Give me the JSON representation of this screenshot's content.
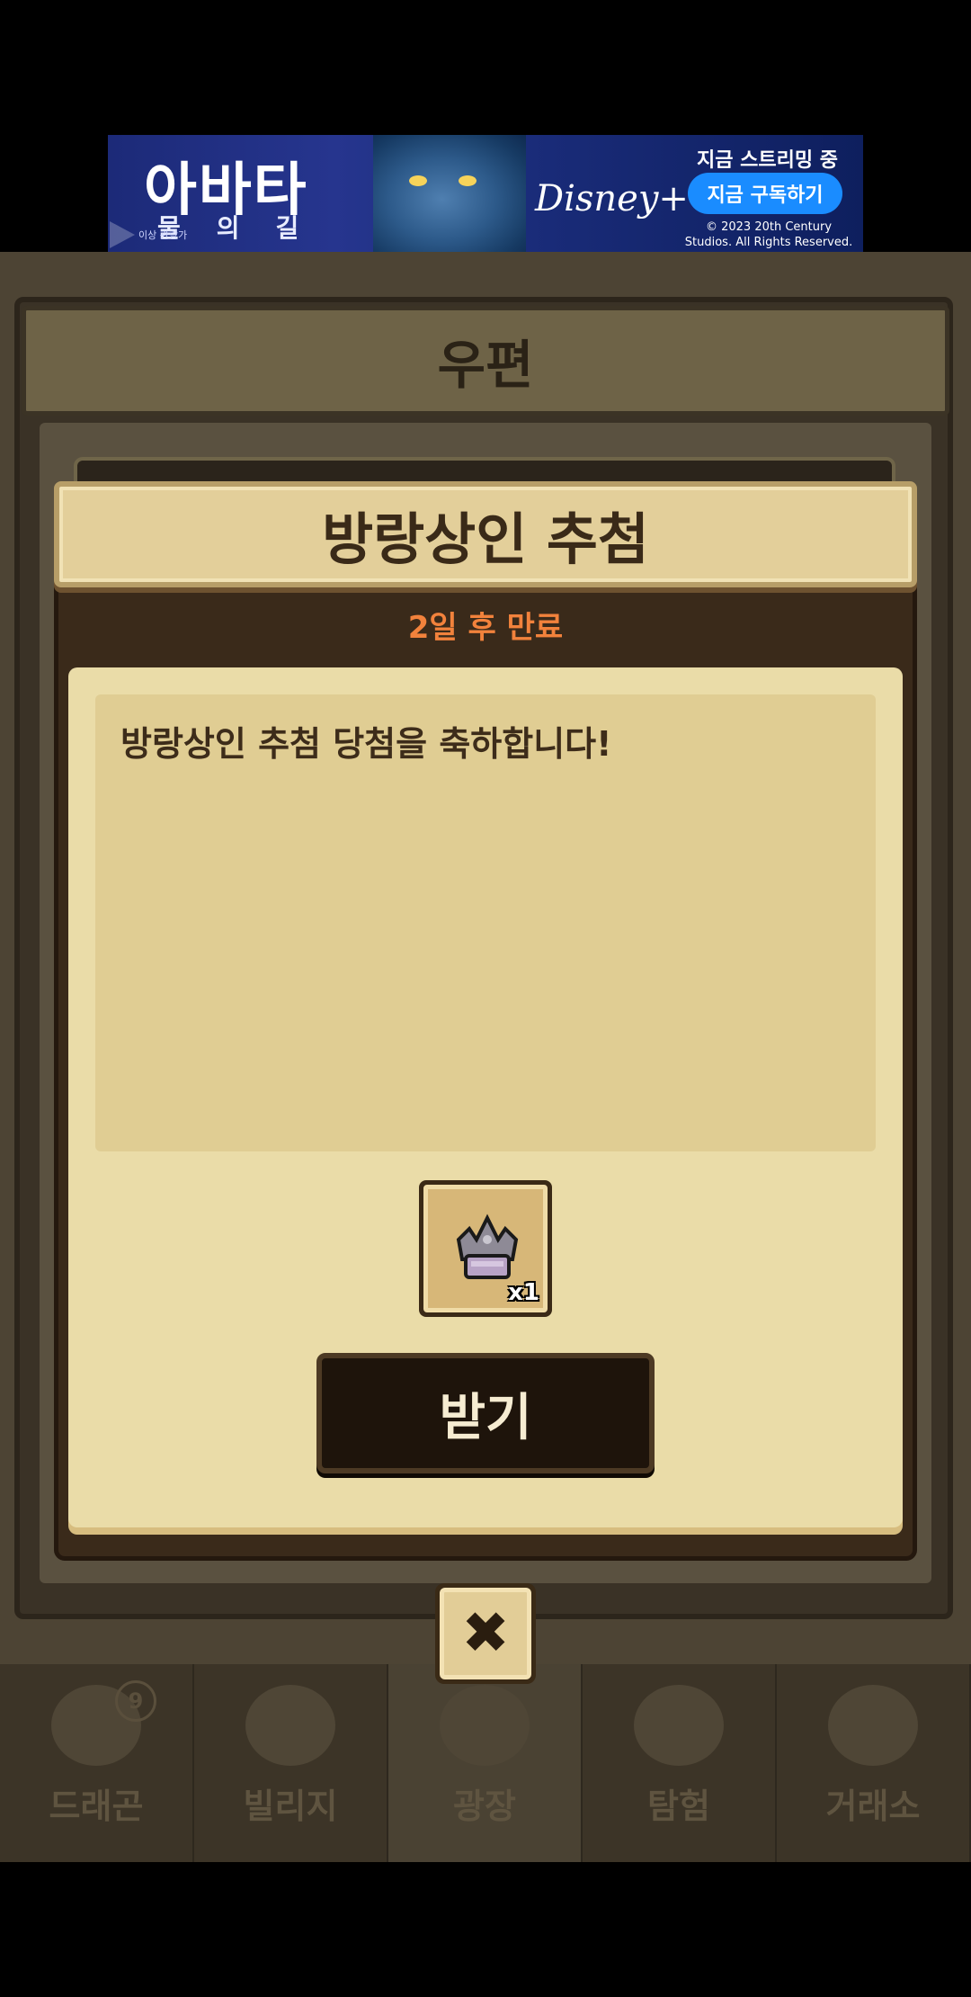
{
  "ad": {
    "title": "아바타",
    "subtitle": "물의길",
    "logo": "Disney+",
    "headline": "지금 스트리밍 중",
    "cta": "지금 구독하기",
    "copyright": "© 2023 20th Century Studios. All Rights Reserved.",
    "badge": "이상 관람가"
  },
  "mail": {
    "title": "우편"
  },
  "modal": {
    "title": "방랑상인 추첨",
    "expire": "2일 후 만료",
    "message": "방랑상인 추첨 당첨을 축하합니다!",
    "item": {
      "icon": "crown-icon",
      "quantity": "x1"
    },
    "receive_label": "받기",
    "close_label": "✖"
  },
  "nav": {
    "items": [
      {
        "label": "드래곤",
        "badge": "9"
      },
      {
        "label": "빌리지",
        "badge": ""
      },
      {
        "label": "광장",
        "badge": ""
      },
      {
        "label": "탐험",
        "badge": ""
      },
      {
        "label": "거래소",
        "badge": ""
      }
    ]
  },
  "colors": {
    "expire": "#f2823c",
    "modal_header": "#e3cf9a",
    "modal_body": "#eadca8",
    "button_dark": "#1e140b"
  }
}
